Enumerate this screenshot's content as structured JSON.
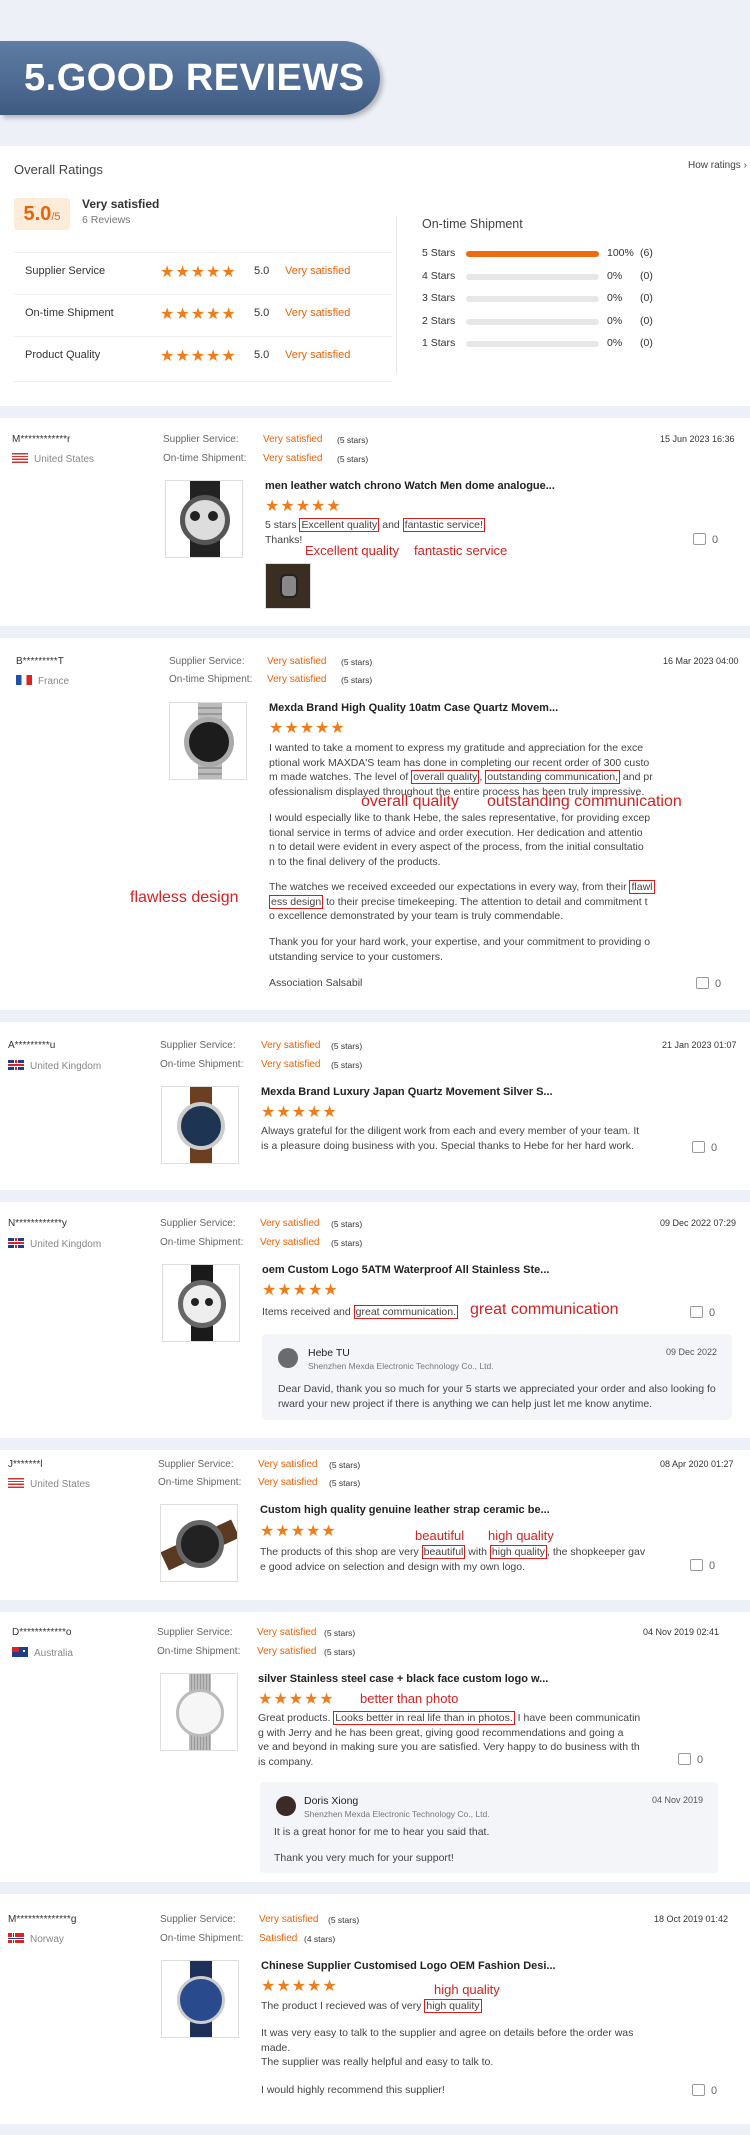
{
  "banner": {
    "title": "5.GOOD REVIEWS"
  },
  "overall": {
    "heading": "Overall Ratings",
    "howlink": "How ratings ›",
    "score": "5.0",
    "outof": "/5",
    "satisfied": "Very satisfied",
    "count": "6 Reviews",
    "rows": [
      {
        "label": "Supplier Service",
        "stars": 5,
        "value": "5.0",
        "text": "Very satisfied"
      },
      {
        "label": "On-time Shipment",
        "stars": 5,
        "value": "5.0",
        "text": "Very satisfied"
      },
      {
        "label": "Product Quality",
        "stars": 5,
        "value": "5.0",
        "text": "Very satisfied"
      }
    ],
    "shipment_heading": "On-time Shipment",
    "dist": [
      {
        "label": "5 Stars",
        "fill": 1.0,
        "pct": "100%",
        "count": "(6)"
      },
      {
        "label": "4 Stars",
        "fill": 0,
        "pct": "0%",
        "count": "(0)"
      },
      {
        "label": "3 Stars",
        "fill": 0,
        "pct": "0%",
        "count": "(0)"
      },
      {
        "label": "2 Stars",
        "fill": 0,
        "pct": "0%",
        "count": "(0)"
      },
      {
        "label": "1 Stars",
        "fill": 0,
        "pct": "0%",
        "count": "(0)"
      }
    ]
  },
  "labels": {
    "supplier": "Supplier Service:",
    "shipment": "On-time Shipment:",
    "v5": "Very satisfied",
    "s5": "(5 stars)",
    "s4": "(4 stars)",
    "sat": "Satisfied"
  },
  "reviews": [
    {
      "user": "M************r",
      "country": "United States",
      "date": "15 Jun 2023 16:36",
      "product": "men leather watch chrono Watch Men dome analogue...",
      "t1": "5 stars",
      "b1": "Excellent quality",
      "t2": " and ",
      "b2": "fantastic service!",
      "t3": "Thanks!",
      "a1": "Excellent quality",
      "a2": "fantastic service",
      "likes": "0"
    },
    {
      "user": "B*********T",
      "country": "France",
      "date": "16 Mar 2023 04:00",
      "product": "Mexda Brand High Quality 10atm Case Quartz Movem...",
      "p1": "I wanted to take a moment to express my gratitude and appreciation for the exce",
      "p2": "ptional work MAXDA'S team has done in completing our recent order of 300 custo",
      "p3a": "m made watches. The level of ",
      "p3b": "overall quality",
      "p3c": ", ",
      "p3d": "outstanding communication,",
      "p3e": " and pr",
      "p4": "ofessionalism displayed throughout the entire process has been truly impressive.",
      "p5": "I would especially like to thank Hebe, the sales representative, for providing excep",
      "p6": "tional service in terms of advice and order execution. Her dedication and attentio",
      "p7": "n to detail were evident in every aspect of the process, from the initial consultatio",
      "p8": "n to the final delivery of the products.",
      "p9a": "The watches we received exceeded our expectations in every way, from their ",
      "p9b": "flawl",
      "p10a": "ess design",
      "p10b": " to their precise timekeeping. The attention to detail and commitment t",
      "p11": "o excellence demonstrated by your team is truly commendable.",
      "p12": "Thank you for your hard work, your expertise, and your commitment to providing o",
      "p13": "utstanding service to your customers.",
      "p14": "Association Salsabil",
      "a1": "overall quality",
      "a2": "outstanding communication",
      "a3": "flawless design",
      "likes": "0"
    },
    {
      "user": "A*********u",
      "country": "United Kingdom",
      "date": "21 Jan 2023 01:07",
      "product": "Mexda Brand Luxury Japan Quartz Movement Silver S...",
      "p1": "Always grateful for the diligent work from each and every member of your team. It",
      "p2": "is a pleasure doing business with you. Special thanks to Hebe for her hard work.",
      "likes": "0"
    },
    {
      "user": "N************y",
      "country": "United Kingdom",
      "date": "09 Dec 2022 07:29",
      "product": "oem Custom Logo 5ATM Waterproof All Stainless Ste...",
      "t1": "Items received and ",
      "b1": "great communication.",
      "a1": "great communication",
      "reply_name": "Hebe TU",
      "reply_company": "Shenzhen Mexda Electronic Technology Co., Ltd.",
      "reply_date": "09 Dec 2022",
      "reply1": "Dear David, thank you so much for your 5 starts we appreciated your order and also looking fo",
      "reply2": "rward your new project if there is anything we can help just let me know anytime.",
      "likes": "0"
    },
    {
      "user": "J*******l",
      "country": "United States",
      "date": "08 Apr 2020 01:27",
      "product": "Custom high quality genuine leather strap ceramic be...",
      "t1": "The products of this shop are very ",
      "b1": "beautiful",
      "t2": " with ",
      "b2": "high quality",
      "t3": ", the shopkeeper gav",
      "t4": "e good advice on selection and design with my own logo.",
      "a1": "beautiful",
      "a2": "high quality",
      "likes": "0"
    },
    {
      "user": "D************o",
      "country": "Australia",
      "date": "04 Nov 2019 02:41",
      "product": "silver Stainless steel case + black face custom logo w...",
      "t1": "Great products. ",
      "b1": "Looks better in real life than in photos.",
      "t2": " I have been communicatin",
      "p2": "g with Jerry and he has been great, giving good recommendations and going a",
      "p3": "ve and beyond in making sure you are satisfied. Very happy to do business with th",
      "p4": "is company.",
      "a1": "better than photo",
      "reply_name": "Doris Xiong",
      "reply_company": "Shenzhen Mexda Electronic Technology Co., Ltd.",
      "reply_date": "04 Nov 2019",
      "reply1": "It is a great honor for me to hear you said that.",
      "reply2": "Thank you very much for your support!",
      "likes": "0"
    },
    {
      "user": "M**************g",
      "country": "Norway",
      "date": "18 Oct 2019 01:42",
      "product": "Chinese Supplier Customised Logo OEM Fashion Desi...",
      "t1": "The product I recieved was of very ",
      "b1": "high quality",
      "t2": "",
      "p2": "It was very easy to talk to the supplier and agree on details before the order was",
      "p3": "made.",
      "p4": "The supplier was really helpful and easy to talk to.",
      "p5": "I would highly recommend this supplier!",
      "a1": "high quality",
      "likes": "0"
    }
  ]
}
